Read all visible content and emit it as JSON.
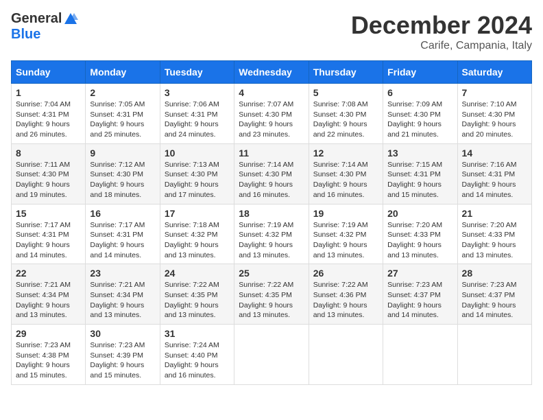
{
  "header": {
    "logo_general": "General",
    "logo_blue": "Blue",
    "month_title": "December 2024",
    "location": "Carife, Campania, Italy"
  },
  "days_of_week": [
    "Sunday",
    "Monday",
    "Tuesday",
    "Wednesday",
    "Thursday",
    "Friday",
    "Saturday"
  ],
  "weeks": [
    [
      {
        "day": "1",
        "sunrise": "7:04 AM",
        "sunset": "4:31 PM",
        "daylight": "9 hours and 26 minutes."
      },
      {
        "day": "2",
        "sunrise": "7:05 AM",
        "sunset": "4:31 PM",
        "daylight": "9 hours and 25 minutes."
      },
      {
        "day": "3",
        "sunrise": "7:06 AM",
        "sunset": "4:31 PM",
        "daylight": "9 hours and 24 minutes."
      },
      {
        "day": "4",
        "sunrise": "7:07 AM",
        "sunset": "4:30 PM",
        "daylight": "9 hours and 23 minutes."
      },
      {
        "day": "5",
        "sunrise": "7:08 AM",
        "sunset": "4:30 PM",
        "daylight": "9 hours and 22 minutes."
      },
      {
        "day": "6",
        "sunrise": "7:09 AM",
        "sunset": "4:30 PM",
        "daylight": "9 hours and 21 minutes."
      },
      {
        "day": "7",
        "sunrise": "7:10 AM",
        "sunset": "4:30 PM",
        "daylight": "9 hours and 20 minutes."
      }
    ],
    [
      {
        "day": "8",
        "sunrise": "7:11 AM",
        "sunset": "4:30 PM",
        "daylight": "9 hours and 19 minutes."
      },
      {
        "day": "9",
        "sunrise": "7:12 AM",
        "sunset": "4:30 PM",
        "daylight": "9 hours and 18 minutes."
      },
      {
        "day": "10",
        "sunrise": "7:13 AM",
        "sunset": "4:30 PM",
        "daylight": "9 hours and 17 minutes."
      },
      {
        "day": "11",
        "sunrise": "7:14 AM",
        "sunset": "4:30 PM",
        "daylight": "9 hours and 16 minutes."
      },
      {
        "day": "12",
        "sunrise": "7:14 AM",
        "sunset": "4:30 PM",
        "daylight": "9 hours and 16 minutes."
      },
      {
        "day": "13",
        "sunrise": "7:15 AM",
        "sunset": "4:31 PM",
        "daylight": "9 hours and 15 minutes."
      },
      {
        "day": "14",
        "sunrise": "7:16 AM",
        "sunset": "4:31 PM",
        "daylight": "9 hours and 14 minutes."
      }
    ],
    [
      {
        "day": "15",
        "sunrise": "7:17 AM",
        "sunset": "4:31 PM",
        "daylight": "9 hours and 14 minutes."
      },
      {
        "day": "16",
        "sunrise": "7:17 AM",
        "sunset": "4:31 PM",
        "daylight": "9 hours and 14 minutes."
      },
      {
        "day": "17",
        "sunrise": "7:18 AM",
        "sunset": "4:32 PM",
        "daylight": "9 hours and 13 minutes."
      },
      {
        "day": "18",
        "sunrise": "7:19 AM",
        "sunset": "4:32 PM",
        "daylight": "9 hours and 13 minutes."
      },
      {
        "day": "19",
        "sunrise": "7:19 AM",
        "sunset": "4:32 PM",
        "daylight": "9 hours and 13 minutes."
      },
      {
        "day": "20",
        "sunrise": "7:20 AM",
        "sunset": "4:33 PM",
        "daylight": "9 hours and 13 minutes."
      },
      {
        "day": "21",
        "sunrise": "7:20 AM",
        "sunset": "4:33 PM",
        "daylight": "9 hours and 13 minutes."
      }
    ],
    [
      {
        "day": "22",
        "sunrise": "7:21 AM",
        "sunset": "4:34 PM",
        "daylight": "9 hours and 13 minutes."
      },
      {
        "day": "23",
        "sunrise": "7:21 AM",
        "sunset": "4:34 PM",
        "daylight": "9 hours and 13 minutes."
      },
      {
        "day": "24",
        "sunrise": "7:22 AM",
        "sunset": "4:35 PM",
        "daylight": "9 hours and 13 minutes."
      },
      {
        "day": "25",
        "sunrise": "7:22 AM",
        "sunset": "4:35 PM",
        "daylight": "9 hours and 13 minutes."
      },
      {
        "day": "26",
        "sunrise": "7:22 AM",
        "sunset": "4:36 PM",
        "daylight": "9 hours and 13 minutes."
      },
      {
        "day": "27",
        "sunrise": "7:23 AM",
        "sunset": "4:37 PM",
        "daylight": "9 hours and 14 minutes."
      },
      {
        "day": "28",
        "sunrise": "7:23 AM",
        "sunset": "4:37 PM",
        "daylight": "9 hours and 14 minutes."
      }
    ],
    [
      {
        "day": "29",
        "sunrise": "7:23 AM",
        "sunset": "4:38 PM",
        "daylight": "9 hours and 15 minutes."
      },
      {
        "day": "30",
        "sunrise": "7:23 AM",
        "sunset": "4:39 PM",
        "daylight": "9 hours and 15 minutes."
      },
      {
        "day": "31",
        "sunrise": "7:24 AM",
        "sunset": "4:40 PM",
        "daylight": "9 hours and 16 minutes."
      },
      null,
      null,
      null,
      null
    ]
  ],
  "labels": {
    "sunrise": "Sunrise:",
    "sunset": "Sunset:",
    "daylight": "Daylight:"
  }
}
